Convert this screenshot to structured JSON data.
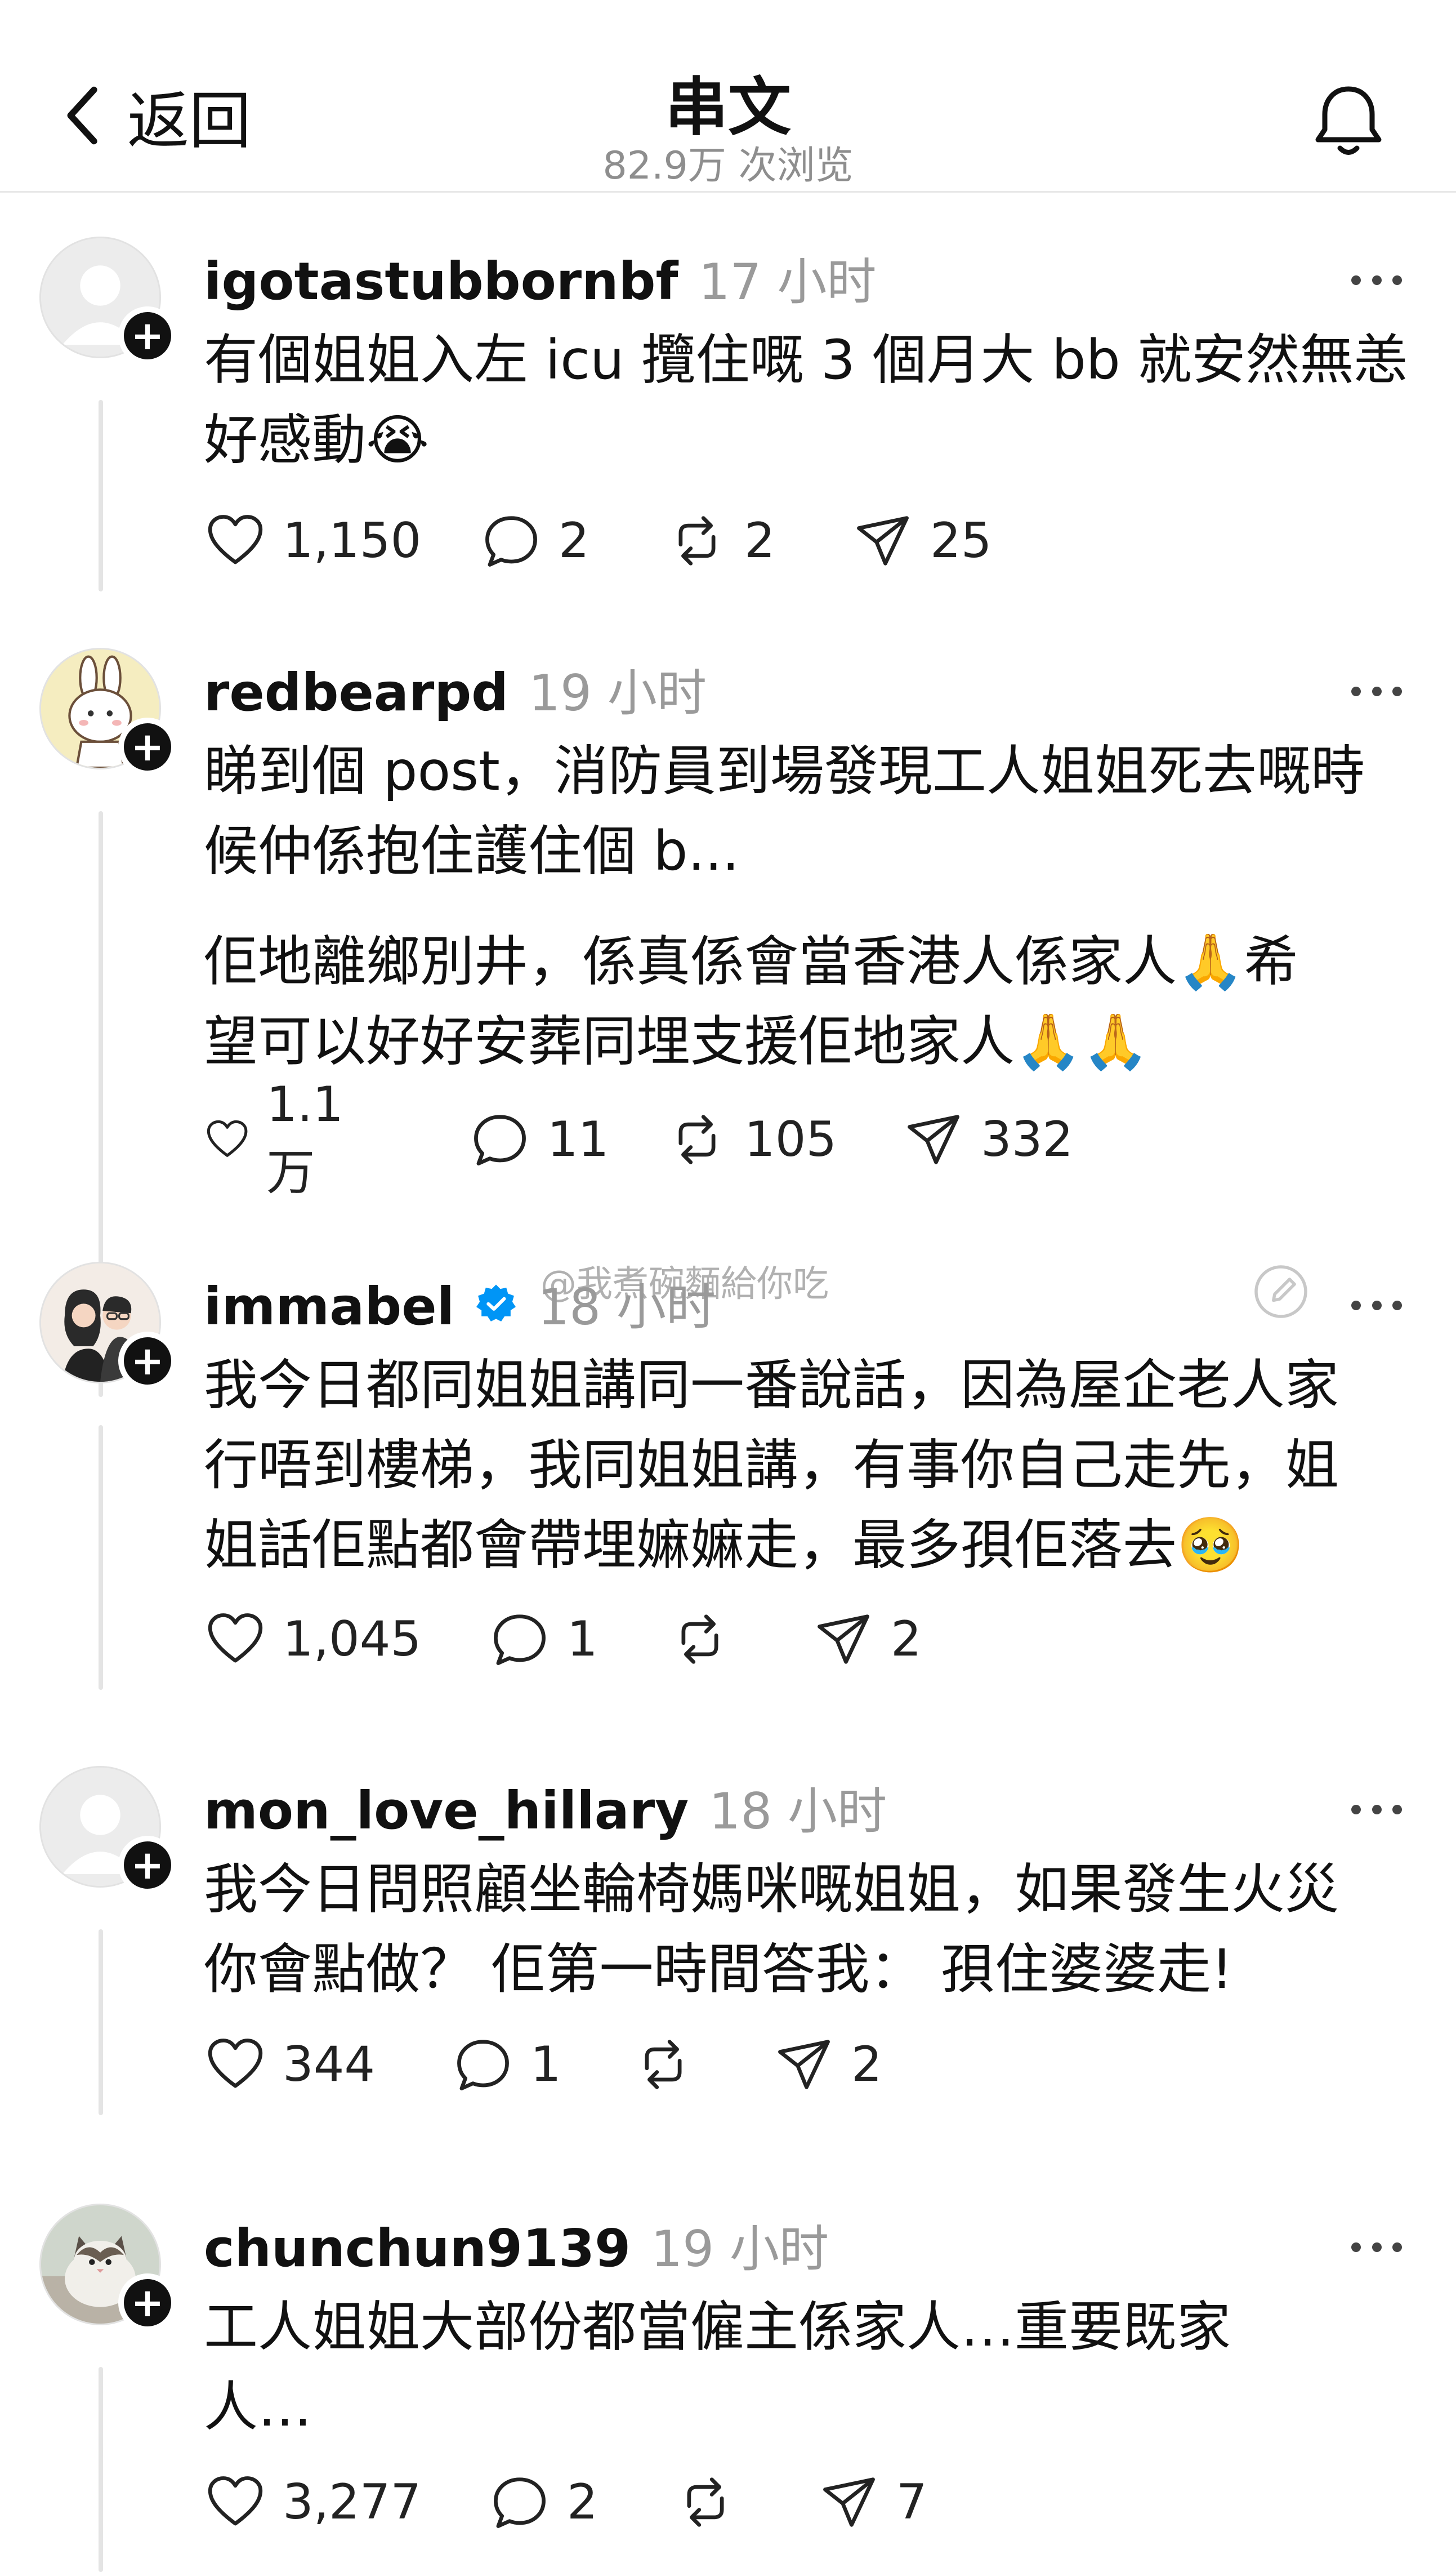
{
  "header": {
    "back_label": "返回",
    "title": "串文",
    "views": "82.9万 次浏览"
  },
  "watermark": "@我煮碗麵給你吃",
  "posts": [
    {
      "username": "igotastubbornbf",
      "time": "17 小时",
      "verified": false,
      "avatar": "default-avatar",
      "paragraphs": [
        "有個姐姐入左 icu 攬住嘅 3 個月大 bb 就安然無恙\n好感動😭"
      ],
      "stats": {
        "likes": "1,150",
        "replies": "2",
        "reposts": "2",
        "shares": "25"
      }
    },
    {
      "username": "redbearpd",
      "time": "19 小时",
      "verified": false,
      "avatar": "cartoon-bunny-avatar",
      "paragraphs": [
        "睇到個 post，消防員到場發現工人姐姐死去嘅時\n候仲係抱住護住個 b...",
        "佢地離鄉別井，係真係會當香港人係家人🙏希\n望可以好好安葬同埋支援佢地家人🙏🙏"
      ],
      "stats": {
        "likes": "1.1万",
        "replies": "11",
        "reposts": "105",
        "shares": "332"
      }
    },
    {
      "username": "immabel",
      "time": "18 小时",
      "verified": true,
      "avatar": "couple-illustration-avatar",
      "paragraphs": [
        "我今日都同姐姐講同一番說話，因為屋企老人家\n行唔到樓梯，我同姐姐講，有事你自己走先，姐\n姐話佢點都會帶埋嫲嫲走，最多孭佢落去🥹"
      ],
      "stats": {
        "likes": "1,045",
        "replies": "1",
        "reposts": "",
        "shares": "2"
      }
    },
    {
      "username": "mon_love_hillary",
      "time": "18 小时",
      "verified": false,
      "avatar": "default-avatar",
      "paragraphs": [
        "我今日問照顧坐輪椅媽咪嘅姐姐，如果發生火災\n你會點做？ 佢第一時間答我： 孭住婆婆走!"
      ],
      "stats": {
        "likes": "344",
        "replies": "1",
        "reposts": "",
        "shares": "2"
      }
    },
    {
      "username": "chunchun9139",
      "time": "19 小时",
      "verified": false,
      "avatar": "cat-photo-avatar",
      "paragraphs": [
        "工人姐姐大部份都當僱主係家人…重要既家\n人…"
      ],
      "stats": {
        "likes": "3,277",
        "replies": "2",
        "reposts": "",
        "shares": "7"
      }
    }
  ],
  "colors": {
    "text": "#111111",
    "muted": "#9a9a9a",
    "verified": "#0095f6",
    "divider": "#e8e8e8"
  }
}
